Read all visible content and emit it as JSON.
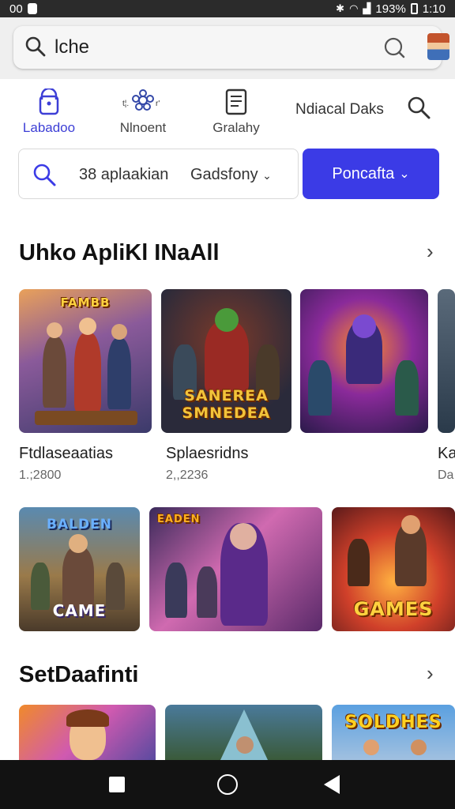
{
  "status_bar": {
    "left_text": "00",
    "battery": "193%",
    "time": "1:10"
  },
  "search": {
    "query": "lche"
  },
  "nav_tabs": [
    {
      "label": "Labadoo",
      "icon": "lock-icon"
    },
    {
      "label": "Nlnoent",
      "icon": "flower-icon"
    },
    {
      "label": "Gralahy",
      "icon": "document-icon"
    }
  ],
  "nav_extra": {
    "label": "Ndiacal Daks"
  },
  "filter": {
    "text": "38 aplaakian",
    "select": "Gadsfony",
    "button": "Poncafta"
  },
  "sections": [
    {
      "title": "Uhko ApliKl INaAll"
    },
    {
      "title": "SetDaafinti"
    }
  ],
  "row1": [
    {
      "name": "Ftdlaseaatias",
      "meta": "1.;2800",
      "art_text": "FAMBB"
    },
    {
      "name": "Splaesridns",
      "meta": "2,,2236",
      "art_text": "SANEREA SMNEDEA"
    },
    {
      "name": "",
      "meta": "",
      "art_text": ""
    },
    {
      "name": "Ka",
      "meta": "Da",
      "art_text": ""
    }
  ],
  "row2": [
    {
      "art_text": "BALDEN",
      "art_sub": "CAME"
    },
    {
      "art_text": "EADEN",
      "art_sub": ""
    },
    {
      "art_text": "GAMES",
      "art_sub": ""
    }
  ],
  "row3": [
    {
      "art_text": ""
    },
    {
      "art_text": ""
    },
    {
      "art_text": "SOLDHES"
    }
  ],
  "colors": {
    "accent": "#3b3be6",
    "active_tab": "#3d3fd6",
    "navbar": "#121212"
  }
}
